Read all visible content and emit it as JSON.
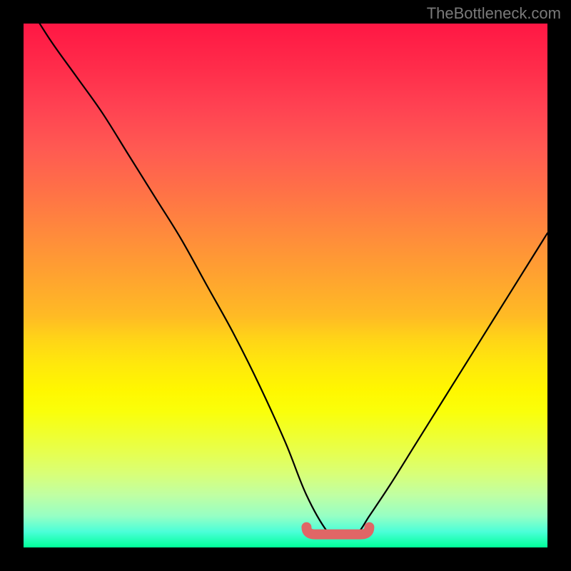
{
  "watermark": "TheBottleneck.com",
  "chart_data": {
    "type": "line",
    "title": "",
    "xlabel": "",
    "ylabel": "",
    "xlim": [
      0,
      100
    ],
    "ylim": [
      0,
      100
    ],
    "series": [
      {
        "name": "curve",
        "x": [
          0,
          5,
          10,
          15,
          20,
          25,
          30,
          35,
          40,
          45,
          50,
          54,
          58,
          60,
          62,
          64,
          66,
          70,
          75,
          80,
          85,
          90,
          95,
          100
        ],
        "values": [
          105,
          97,
          90,
          83,
          75,
          67,
          59,
          50,
          41,
          31,
          20,
          10,
          3,
          2,
          2,
          3,
          6,
          12,
          20,
          28,
          36,
          44,
          52,
          60
        ]
      }
    ],
    "highlight": {
      "name": "minimum-region",
      "x_start": 54,
      "x_end": 66,
      "y": 2.5
    },
    "colors": {
      "curve": "#000000",
      "highlight": "#e06666",
      "gradient_top": "#ff1744",
      "gradient_bottom": "#00ff99"
    }
  }
}
